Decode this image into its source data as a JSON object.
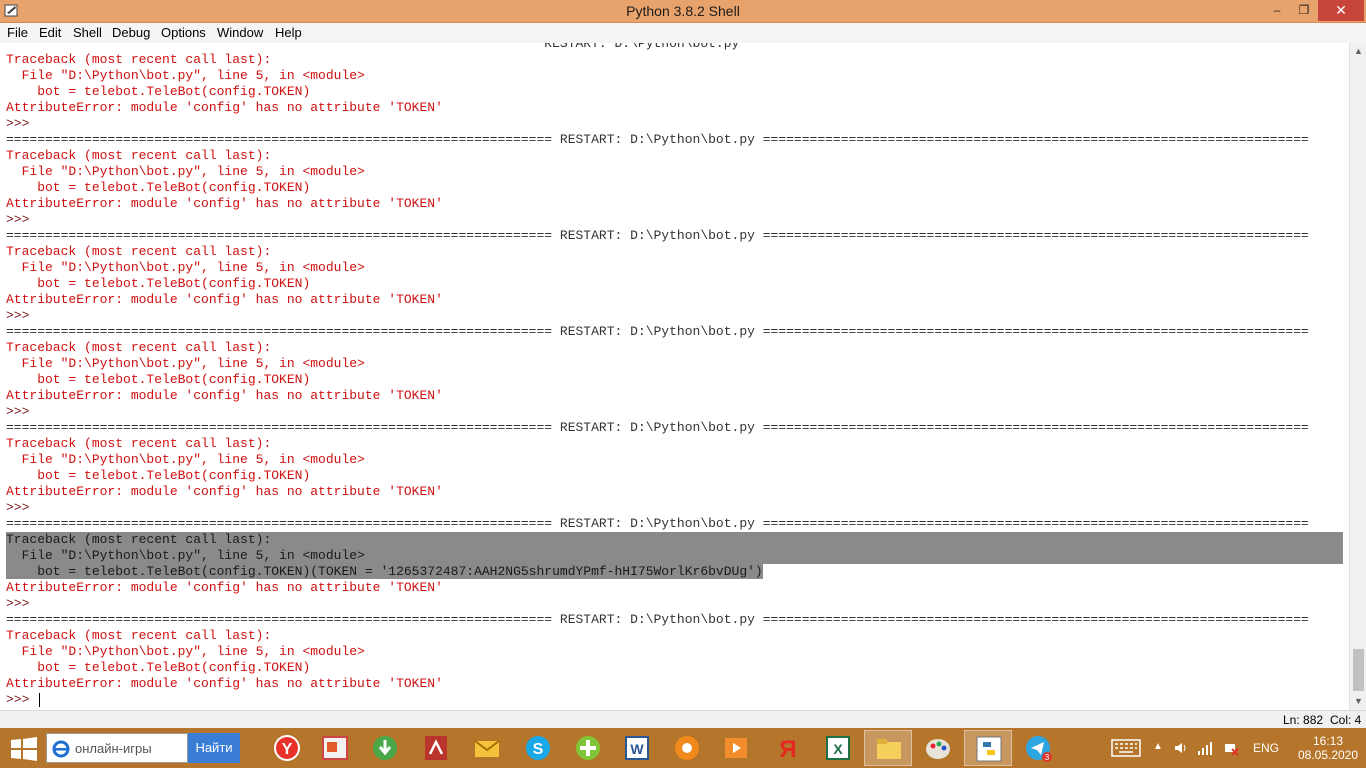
{
  "window": {
    "title": "Python 3.8.2 Shell",
    "minimize": "‒",
    "maximize": "❐",
    "close": "✕"
  },
  "menu": [
    "File",
    "Edit",
    "Shell",
    "Debug",
    "Options",
    "Window",
    "Help"
  ],
  "shell": {
    "top_partial": "                                                                     RESTART: D:\\Python\\bot.py",
    "restart_line": "====================================================================== RESTART: D:\\Python\\bot.py ======================================================================",
    "tb1": "Traceback (most recent call last):",
    "tb2": "  File \"D:\\Python\\bot.py\", line 5, in <module>",
    "tb3": "    bot = telebot.TeleBot(config.TOKEN)",
    "tb3_pasted": "    bot = telebot.TeleBot(config.TOKEN)(TOKEN = '1265372487:AAH2NG5shrumdYPmf-hHI75WorlKr6bvDUg')",
    "tb4": "AttributeError: module 'config' has no attribute 'TOKEN'",
    "prompt": ">>>",
    "prompt_last": ">>> "
  },
  "status": {
    "line": "Ln: 882",
    "col": "Col: 4"
  },
  "taskbar": {
    "search_placeholder": "онлайн-игры",
    "search_button": "Найти",
    "apps": [
      {
        "name": "yandex-browser-icon"
      },
      {
        "name": "presentation-app-icon"
      },
      {
        "name": "download-app-icon"
      },
      {
        "name": "pdf-reader-icon"
      },
      {
        "name": "mail-app-icon"
      },
      {
        "name": "skype-icon"
      },
      {
        "name": "icq-icon"
      },
      {
        "name": "word-icon"
      },
      {
        "name": "games-app-icon"
      },
      {
        "name": "video-player-icon"
      },
      {
        "name": "yandex-icon"
      },
      {
        "name": "excel-icon"
      },
      {
        "name": "file-explorer-icon"
      },
      {
        "name": "paint-icon"
      },
      {
        "name": "python-idle-icon"
      },
      {
        "name": "telegram-icon"
      }
    ],
    "telegram_badge": "3",
    "lang": "ENG",
    "time": "16:13",
    "date": "08.05.2020"
  },
  "colors": {
    "titlebar": "#e8a26b",
    "taskbar": "#b5752a",
    "error_text": "#d01010",
    "selection": "#8a8a8a"
  }
}
